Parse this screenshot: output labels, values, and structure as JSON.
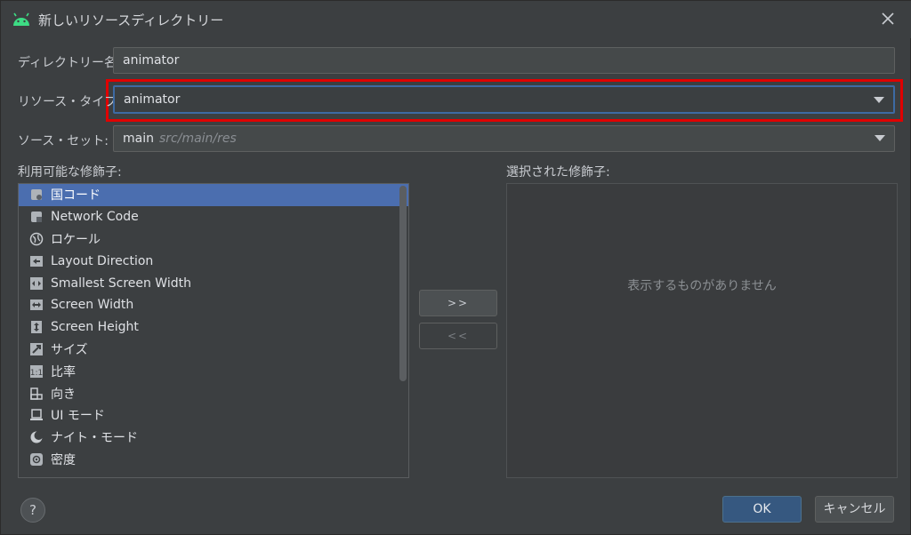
{
  "window": {
    "title": "新しいリソースディレクトリー"
  },
  "form": {
    "directory_name_label": "ディレクトリー名:",
    "directory_name_value": "animator",
    "resource_type_label": "リソース・タイプ:",
    "resource_type_value": "animator",
    "source_set_label": "ソース・セット:",
    "source_set_value": "main",
    "source_set_path": "src/main/res"
  },
  "available": {
    "label": "利用可能な修飾子:",
    "items": [
      {
        "label": "国コード",
        "icon": "country-code-icon",
        "selected": true
      },
      {
        "label": "Network Code",
        "icon": "network-code-icon"
      },
      {
        "label": "ロケール",
        "icon": "globe-icon"
      },
      {
        "label": "Layout Direction",
        "icon": "layout-direction-icon"
      },
      {
        "label": "Smallest Screen Width",
        "icon": "smallest-width-icon"
      },
      {
        "label": "Screen Width",
        "icon": "screen-width-icon"
      },
      {
        "label": "Screen Height",
        "icon": "screen-height-icon"
      },
      {
        "label": "サイズ",
        "icon": "size-icon"
      },
      {
        "label": "比率",
        "icon": "ratio-icon"
      },
      {
        "label": "向き",
        "icon": "orientation-icon"
      },
      {
        "label": "UI モード",
        "icon": "ui-mode-icon"
      },
      {
        "label": "ナイト・モード",
        "icon": "night-mode-icon"
      },
      {
        "label": "密度",
        "icon": "density-icon"
      }
    ]
  },
  "selected": {
    "label": "選択された修飾子:",
    "empty_text": "表示するものがありません"
  },
  "transfer": {
    "add_label": ">>",
    "remove_label": "<<"
  },
  "buttons": {
    "help": "?",
    "ok": "OK",
    "cancel": "キャンセル"
  },
  "colors": {
    "selection": "#4b6eaf",
    "highlight": "#e00000",
    "android_green": "#3ddc84"
  }
}
